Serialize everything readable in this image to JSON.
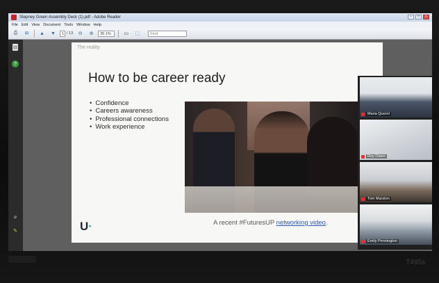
{
  "window": {
    "title": "Stepney Green Assembly Deck (1).pdf - Adobe Reader",
    "buttons": {
      "minimize": "–",
      "maximize": "□",
      "close": "×"
    }
  },
  "menu": {
    "items": [
      "File",
      "Edit",
      "View",
      "Document",
      "Tools",
      "Window",
      "Help"
    ]
  },
  "toolbar": {
    "page_current": "1",
    "page_total": "/ 13",
    "zoom": "35.1%",
    "find_placeholder": "Find"
  },
  "icons": {
    "app": "adobe-reader-icon",
    "print": "print-icon",
    "email": "email-icon",
    "prev": "prev-page-icon",
    "next": "next-page-icon",
    "zoom_out": "zoom-out-icon",
    "zoom_in": "zoom-in-icon",
    "fit": "fit-page-icon",
    "select": "select-tool-icon",
    "pages": "pages-panel-icon",
    "help": "help-icon",
    "attach": "attachment-icon",
    "comment": "comment-icon"
  },
  "slide": {
    "header": "The reality",
    "title": "How to be career ready",
    "bullets": [
      "Confidence",
      "Careers awareness",
      "Professional connections",
      "Work experience"
    ],
    "caption_prefix": "A recent #FuturesUP ",
    "caption_link": "networking video",
    "caption_suffix": ".",
    "logo_text": "U",
    "logo_dot": "·"
  },
  "participants": [
    {
      "name": "Maria Querol"
    },
    {
      "name": "Roy Owen"
    },
    {
      "name": "Tom Marston"
    },
    {
      "name": "Emily Pennington"
    }
  ],
  "monitor": {
    "model": "T495s"
  },
  "colors": {
    "accent_blue": "#2a59b8",
    "logo_teal": "#2aa6a1",
    "mic_muted_red": "#dd3333"
  }
}
